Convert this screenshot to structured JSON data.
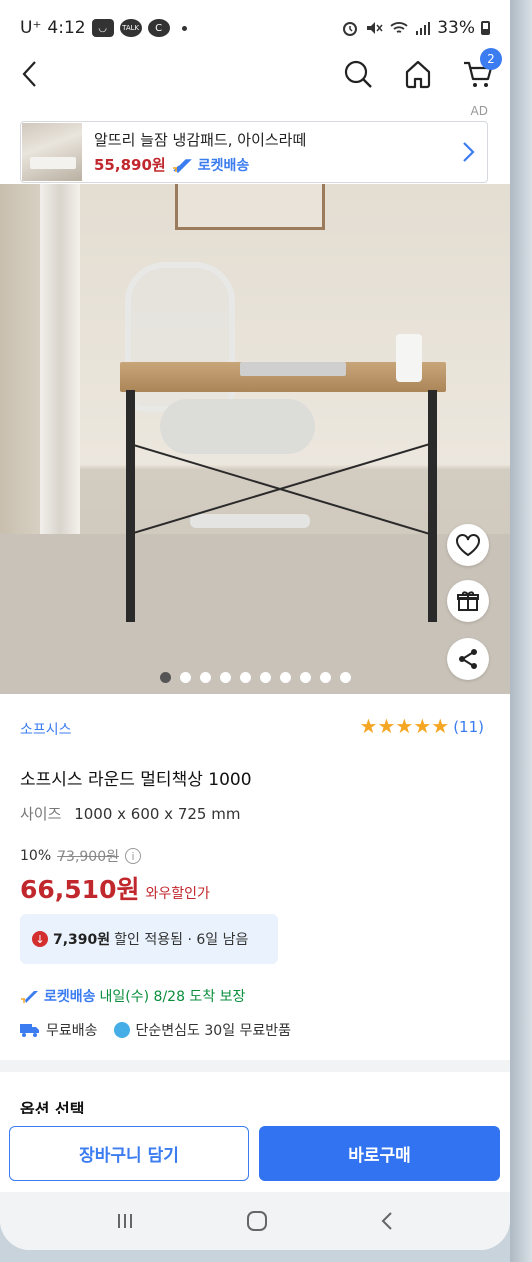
{
  "status_bar": {
    "carrier": "U⁺",
    "time": "4:12",
    "apps": [
      "◡",
      "TALK",
      "C"
    ],
    "battery": "33%"
  },
  "nav": {
    "cart_count": "2"
  },
  "ad": {
    "tag": "AD",
    "title": "알뜨리 늘잠 냉감패드, 아이스라떼",
    "price": "55,890원",
    "rocket": "로켓배송"
  },
  "gallery": {
    "image_count": 10,
    "active_index": 0
  },
  "product": {
    "brand": "소프시스",
    "rating_stars": 5,
    "review_count": "(11)",
    "title": "소프시스 라운드 멀티책상 1000",
    "size_label": "사이즈",
    "size_value": "1000 x 600 x 725 mm",
    "discount_pct": "10%",
    "original_price": "73,900원",
    "price": "66,510원",
    "wow_label": "와우할인가",
    "coupon_amount": "7,390원",
    "coupon_text": "할인 적용됨 · 6일 남음",
    "delivery_brand": "로켓배송",
    "delivery_date": "내일(수) 8/28 도착 보장",
    "free_shipping": "무료배송",
    "free_return": "단순변심도 30일 무료반품"
  },
  "options": {
    "heading": "옵션 선택"
  },
  "actions": {
    "cart_label": "장바구니 담기",
    "buy_label": "바로구매"
  },
  "colors": {
    "accent": "#3173f0",
    "price_red": "#c0282e",
    "star": "#f5a623",
    "delivery_green": "#0a8f3c"
  }
}
